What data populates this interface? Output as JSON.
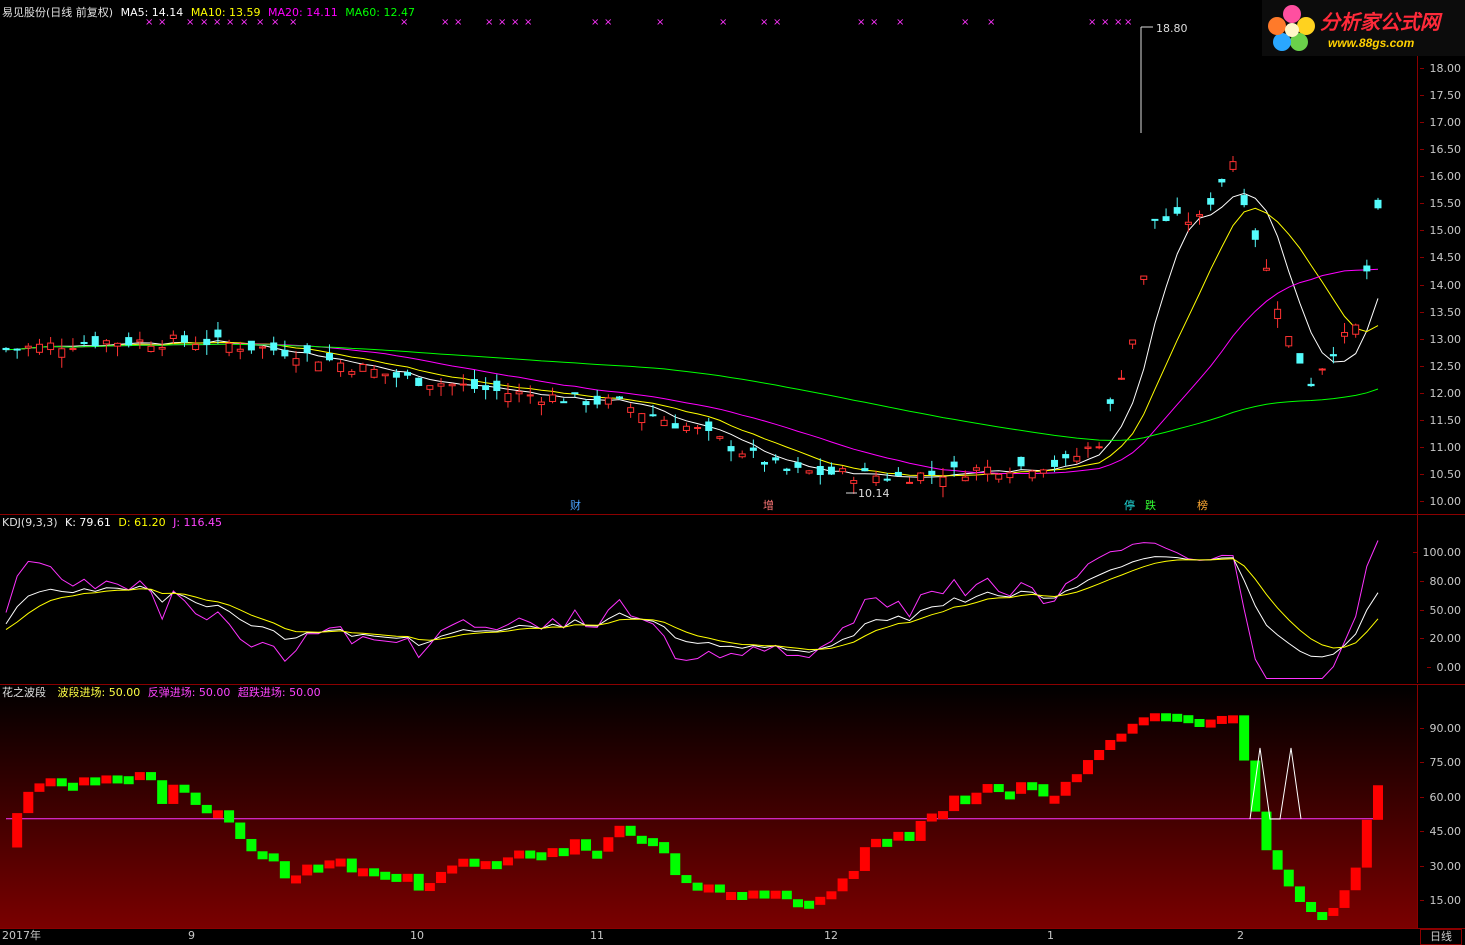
{
  "header": {
    "stock": "易见股份(日线 前复权)",
    "ma5_label": "MA5: 14.14",
    "ma10_label": "MA10: 13.59",
    "ma20_label": "MA20: 14.11",
    "ma60_label": "MA60: 12.47"
  },
  "logo": {
    "name": "分析家公式网",
    "url": "www.88gs.com"
  },
  "price_axis": [
    "18.00",
    "17.50",
    "17.00",
    "16.50",
    "16.00",
    "15.50",
    "15.00",
    "14.50",
    "14.00",
    "13.50",
    "13.00",
    "12.50",
    "12.00",
    "11.50",
    "11.00",
    "10.50",
    "10.00"
  ],
  "price_notes": {
    "high": "18.80",
    "low": "10.14"
  },
  "markers": [
    {
      "text": "财",
      "color": "#4aa3ff"
    },
    {
      "text": "增",
      "color": "#ff7777"
    },
    {
      "text": "停",
      "color": "#22e0e0"
    },
    {
      "text": "跌",
      "color": "#33ff33"
    },
    {
      "text": "榜",
      "color": "#ffaa33"
    }
  ],
  "kdj": {
    "title": "KDJ(9,3,3)",
    "k_label": "K: 79.61",
    "d_label": "D: 61.20",
    "j_label": "J: 116.45",
    "axis": [
      "100.00",
      "80.00",
      "50.00",
      "20.00",
      "0.00"
    ]
  },
  "flower": {
    "title": "花之波段",
    "wave_label": "波段进场: 50.00",
    "rebound_label": "反弹进场: 50.00",
    "oversold_label": "超跌进场: 50.00",
    "axis": [
      "90.00",
      "75.00",
      "60.00",
      "45.00",
      "30.00",
      "15.00"
    ]
  },
  "time_axis": [
    "2017年",
    "9",
    "10",
    "11",
    "12",
    "1",
    "2"
  ],
  "period": "日线",
  "colors": {
    "up": "#ff3232",
    "down": "#54fcfc",
    "ma5": "#ffffff",
    "ma10": "#ffff00",
    "ma20": "#ff00ff",
    "ma60": "#00ff00",
    "frame": "#8b0000",
    "bar_up": "#ff0000",
    "bar_down": "#00ff00"
  }
}
